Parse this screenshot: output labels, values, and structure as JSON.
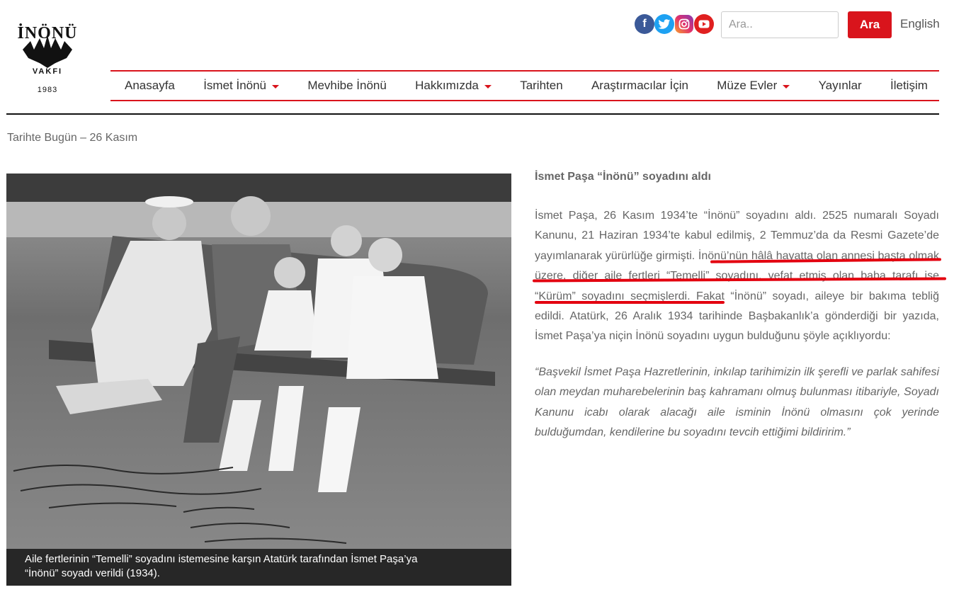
{
  "logo": {
    "name": "İNÖNÜ",
    "sub": "VAKFI",
    "year": "1983"
  },
  "social": [
    "facebook-icon",
    "twitter-icon",
    "instagram-icon",
    "youtube-icon"
  ],
  "search": {
    "placeholder": "Ara..",
    "button": "Ara"
  },
  "language_link": "English",
  "nav": [
    {
      "label": "Anasayfa",
      "dropdown": false
    },
    {
      "label": "İsmet İnönü",
      "dropdown": true
    },
    {
      "label": "Mevhibe İnönü",
      "dropdown": false
    },
    {
      "label": "Hakkımızda",
      "dropdown": true
    },
    {
      "label": "Tarihten",
      "dropdown": false
    },
    {
      "label": "Araştırmacılar İçin",
      "dropdown": false
    },
    {
      "label": "Müze Evler",
      "dropdown": true
    },
    {
      "label": "Yayınlar",
      "dropdown": false
    },
    {
      "label": "İletişim",
      "dropdown": false
    }
  ],
  "breadcrumb": "Tarihte Bugün – 26 Kasım",
  "photo": {
    "caption_line1": "Aile fertlerinin “Temelli” soyadını istemesine karşın Atatürk tarafından İsmet Paşa’ya",
    "caption_line2": "“İnönü” soyadı verildi (1934)."
  },
  "article": {
    "title": "İsmet Paşa “İnönü” soyadını aldı",
    "body": "İsmet Paşa, 26 Kasım 1934’te “İnönü” soyadını aldı. 2525 numaralı Soyadı Kanunu, 21 Haziran 1934’te kabul edilmiş, 2 Temmuz’da da Resmi Gazete’de yayımlanarak yürürlüğe girmişti. İnönü’nün hâlâ hayatta olan annesi başta olmak üzere, diğer aile fertleri “Temelli” soyadını, vefat etmiş olan baba tarafı ise “Kürüm” soyadını  seçmişlerdi. Fakat “İnönü” soyadı, aileye bir bakıma tebliğ edildi. Atatürk, 26 Aralık 1934 tarihinde Başbakanlık’a gönderdiği bir yazıda, İsmet Paşa’ya niçin İnönü soyadını uygun bulduğunu şöyle açıklıyordu:",
    "quote": "“Başvekil İsmet Paşa Hazretlerinin, inkılap tarihimizin ilk şerefli ve parlak sahifesi olan meydan muharebelerinin baş kahramanı olmuş bulunması itibariyle, Soyadı Kanunu icabı olarak alacağı aile isminin İnönü olmasını çok yerinde bulduğumdan, kendilerine bu soyadını tevcih ettiğimi bildiririm.”"
  },
  "colors": {
    "accent": "#d9141c",
    "text": "#666666",
    "annotation": "#e3000f"
  }
}
